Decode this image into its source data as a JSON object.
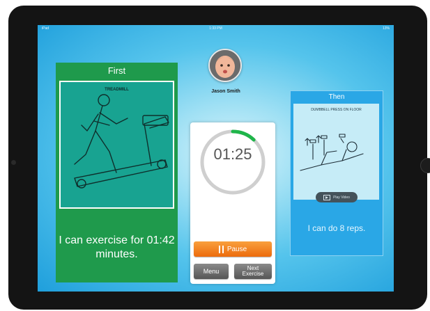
{
  "status_bar": {
    "carrier": "iPad",
    "time": "1:33 PM",
    "battery": "13%"
  },
  "student": {
    "name": "Jason Smith"
  },
  "first": {
    "title": "First",
    "exercise_name": "TREADMILL",
    "description": "I can exercise for 01:42 minutes."
  },
  "timer": {
    "time": "01:25",
    "progress_fraction": 0.12,
    "pause_label": "Pause",
    "menu_label": "Menu",
    "next_label": "Next\nExercise"
  },
  "then": {
    "title": "Then",
    "exercise_name": "DUMBBELL PRESS ON FLOOR",
    "play_video_label": "Play Video",
    "description": "I can do 8 reps."
  },
  "colors": {
    "first_card": "#1f9a4c",
    "then_card": "#2aa7e6",
    "pause_orange": "#f08a1f",
    "timer_progress": "#1fb54a"
  },
  "icons": {
    "pause": "pause-icon",
    "play_video": "play-video-icon"
  }
}
